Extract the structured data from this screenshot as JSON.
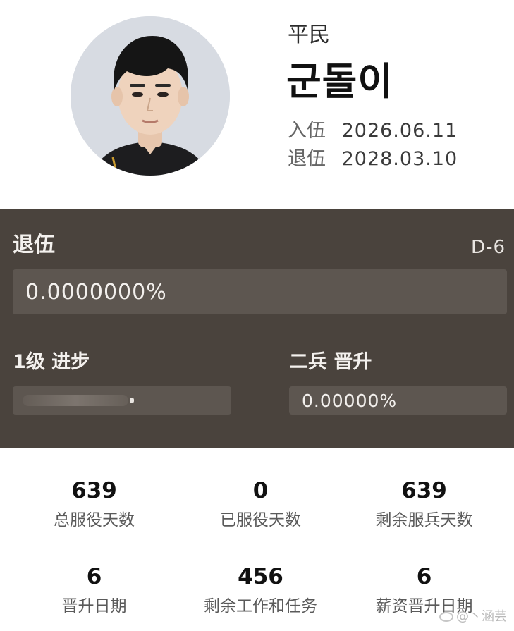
{
  "profile": {
    "rank": "平民",
    "name": "군돌이",
    "enlist_label": "入伍",
    "enlist_date": "2026.06.11",
    "discharge_label": "退伍",
    "discharge_date": "2028.03.10"
  },
  "discharge_progress": {
    "title": "退伍",
    "dday": "D-6",
    "percent_text": "0.0000000%",
    "percent": 0
  },
  "level_progress": {
    "label": "1级 进步"
  },
  "promotion_progress": {
    "label": "二兵 晋升",
    "percent_text": "0.00000%",
    "percent": 0
  },
  "stats": [
    {
      "value": "639",
      "caption": "总服役天数"
    },
    {
      "value": "0",
      "caption": "已服役天数"
    },
    {
      "value": "639",
      "caption": "剩余服兵天数"
    },
    {
      "value": "6",
      "caption": "晋升日期"
    },
    {
      "value": "456",
      "caption": "剩余工作和任务"
    },
    {
      "value": "6",
      "caption": "薪资晋升日期"
    }
  ],
  "watermark": "@丶涵芸",
  "colors": {
    "panel_background": "#4a433d",
    "bar_track": "#5d5650"
  }
}
